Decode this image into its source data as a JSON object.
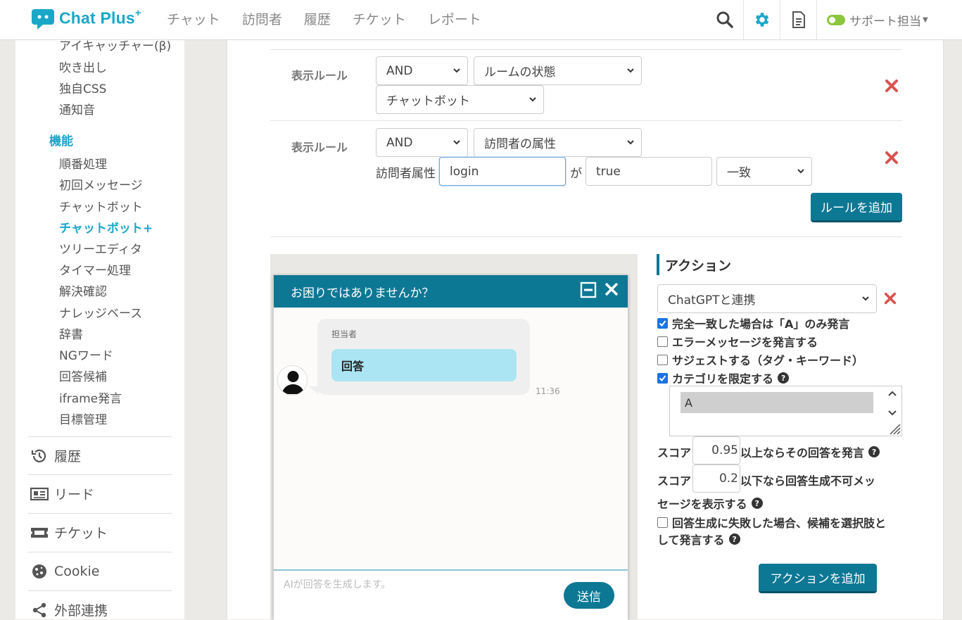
{
  "app": {
    "logo_text": "Chat Plus",
    "logo_plus": "+"
  },
  "nav": [
    "チャット",
    "訪問者",
    "履歴",
    "チケット",
    "レポート"
  ],
  "user": {
    "name": "サポート担当",
    "status_color": "#8cc63f"
  },
  "colors": {
    "accent": "#1aa7c7",
    "teal": "#0d7894",
    "danger": "#d9534f"
  },
  "sidebar": {
    "design_items": [
      "アイキャッチャー(β)",
      "吹き出し",
      "独自CSS",
      "通知音"
    ],
    "feature_heading": "機能",
    "feature_items": [
      "順番処理",
      "初回メッセージ",
      "チャットボット",
      "チャットボット+",
      "ツリーエディタ",
      "タイマー処理",
      "解決確認",
      "ナレッジベース",
      "辞書",
      "NGワード",
      "回答候補",
      "iframe発言",
      "目標管理"
    ],
    "active_item": "チャットボット+",
    "main_items": [
      {
        "label": "履歴",
        "icon": "history-icon"
      },
      {
        "label": "リード",
        "icon": "lead-icon"
      },
      {
        "label": "チケット",
        "icon": "ticket-icon"
      },
      {
        "label": "Cookie",
        "icon": "cookie-icon"
      },
      {
        "label": "外部連携",
        "icon": "share-icon"
      }
    ]
  },
  "rules": [
    {
      "label": "表示ルール",
      "operator": "AND",
      "field": "ルームの状態",
      "value": "チャットボット"
    },
    {
      "label": "表示ルール",
      "operator": "AND",
      "field": "訪問者の属性",
      "attr_label": "訪問者属性",
      "attr_value": "login",
      "ga": "が",
      "compare_value": "true",
      "match": "一致"
    }
  ],
  "add_rule_button": "ルールを追加",
  "chat_preview": {
    "title": "お困りではありませんか？",
    "agent_name": "担当者",
    "message": "回答",
    "time": "11:36",
    "placeholder": "AIが回答を生成します。",
    "send_label": "送信"
  },
  "action": {
    "title": "アクション",
    "type": "ChatGPTと連携",
    "checkboxes": [
      {
        "label": "完全一致した場合は「A」のみ発言",
        "checked": true
      },
      {
        "label": "エラーメッセージを発言する",
        "checked": false
      },
      {
        "label": "サジェストする（タグ・キーワード）",
        "checked": false
      },
      {
        "label": "カテゴリを限定する",
        "checked": true
      }
    ],
    "category_options": [
      "A"
    ],
    "score1": {
      "prefix": "スコア",
      "value": "0.95",
      "suffix": "以上ならその回答を発言"
    },
    "score2": {
      "prefix": "スコア",
      "value": "0.2",
      "suffix_line1": "以下なら回答生成不可メッ",
      "suffix_line2": "セージを表示する"
    },
    "fallback": {
      "line1": "回答生成に失敗した場合、候補を選択肢と",
      "line2": "して発言する",
      "checked": false
    },
    "add_button": "アクションを追加"
  }
}
